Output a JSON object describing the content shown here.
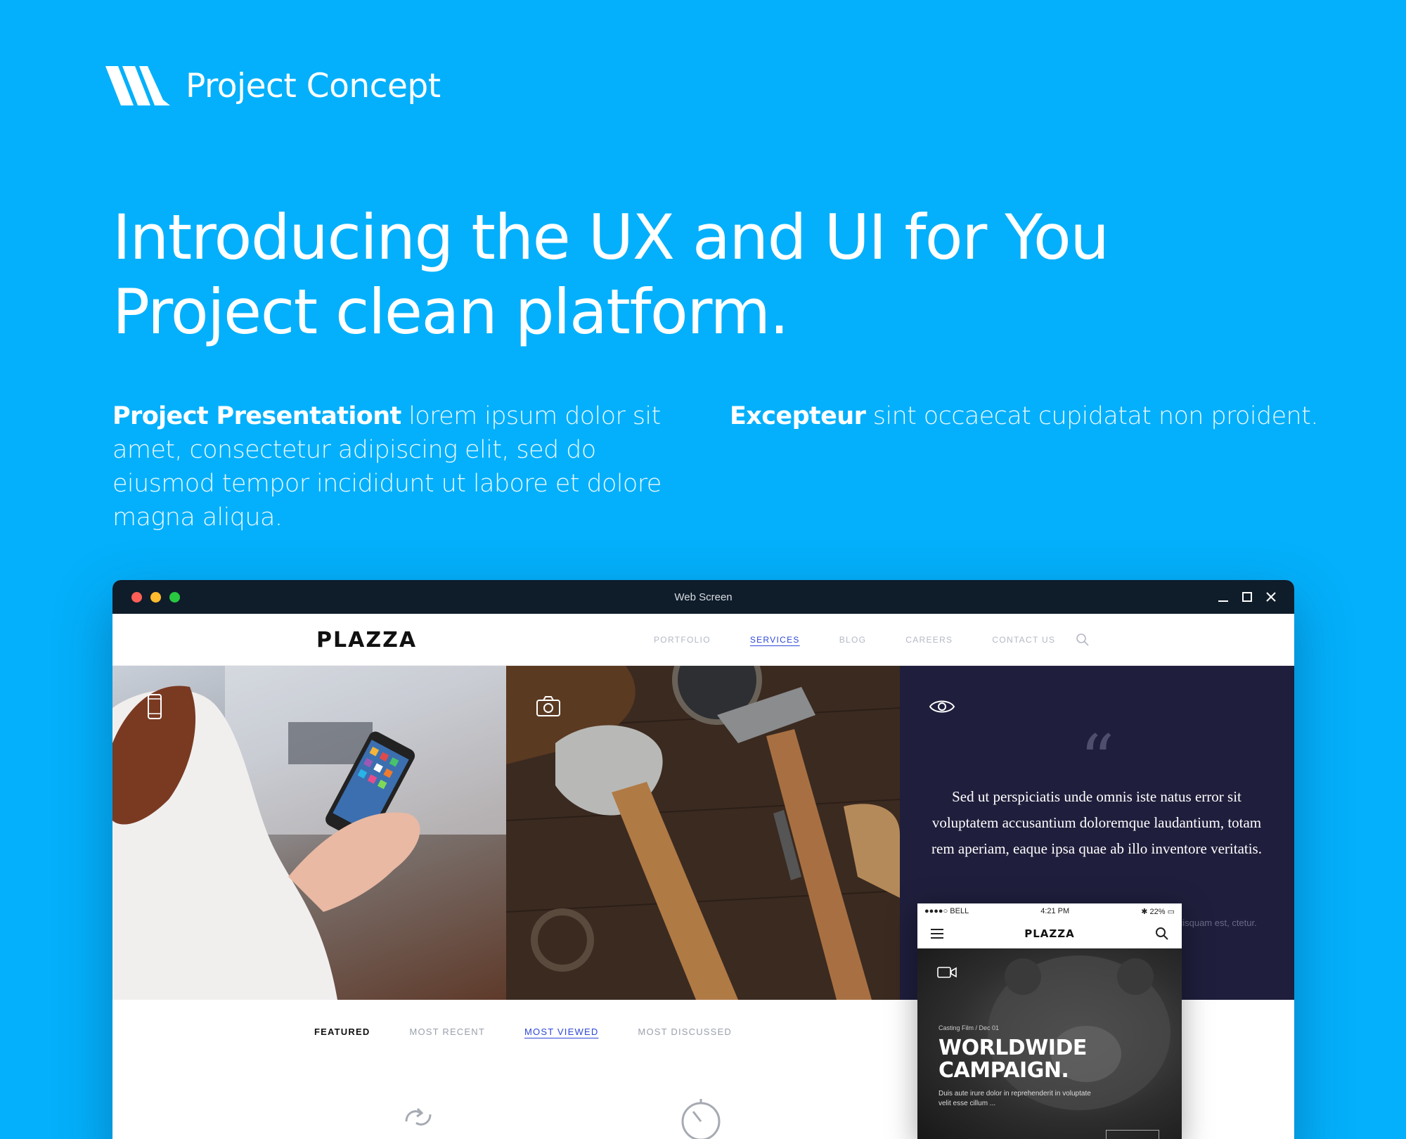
{
  "brand": {
    "name": "Project Concept"
  },
  "hero": {
    "headline": "Introducing the UX and UI for You Project clean platform.",
    "left_bold": "Project Presentationt",
    "left_text": " lorem ipsum dolor sit amet, consectetur adipiscing elit, sed do eiusmod tempor incididunt ut labore et dolore magna aliqua.",
    "right_bold": "Excepteur",
    "right_text": " sint occaecat cupidatat non proident."
  },
  "window": {
    "title": "Web Screen",
    "colors": {
      "close": "#ff5f57",
      "minimize": "#febc2e",
      "zoom": "#28c840"
    }
  },
  "site": {
    "logo": "PLAZZA",
    "nav": [
      {
        "label": "PORTFOLIO",
        "active": false
      },
      {
        "label": "SERVICES",
        "active": true
      },
      {
        "label": "BLOG",
        "active": false
      },
      {
        "label": "CAREERS",
        "active": false
      },
      {
        "label": "CONTACT US",
        "active": false
      }
    ],
    "quote": {
      "mark": "“",
      "text": "Sed ut perspiciatis unde omnis iste natus error sit voluptatem accusantium doloremque laudantium, totam rem aperiam, eaque ipsa quae ab illo inventore veritatis.",
      "ghost": "uisquam est, ctetur."
    },
    "tabs": [
      {
        "label": "FEATURED",
        "state": "bold"
      },
      {
        "label": "MOST RECENT",
        "state": "normal"
      },
      {
        "label": "MOST VIEWED",
        "state": "selected"
      },
      {
        "label": "MOST DISCUSSED",
        "state": "normal"
      }
    ]
  },
  "phone": {
    "carrier": "●●●●○ BELL",
    "time": "4:21 PM",
    "battery": "22%",
    "logo": "PLAZZA",
    "crumb": "Casting Film / Dec 01",
    "title": "WORLDWIDE CAMPAIGN.",
    "desc": "Duis aute irure dolor in reprehenderit in voluptate velit esse cillum ..."
  }
}
